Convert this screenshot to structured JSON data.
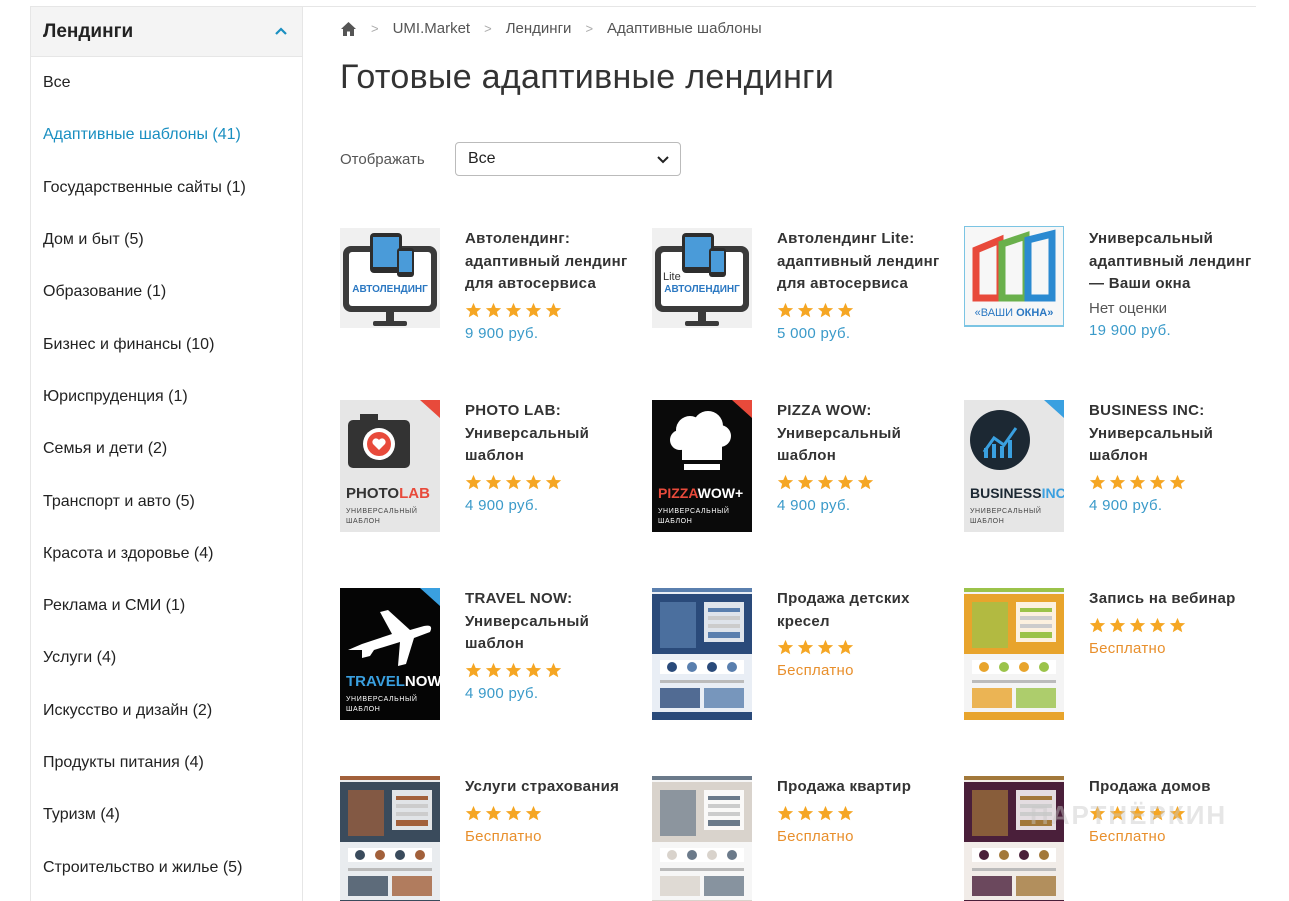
{
  "sidebar": {
    "title": "Лендинги",
    "items": [
      {
        "label": "Все",
        "active": false
      },
      {
        "label": "Адаптивные шаблоны (41)",
        "active": true
      },
      {
        "label": "Государственные сайты (1)",
        "active": false
      },
      {
        "label": "Дом и быт (5)",
        "active": false
      },
      {
        "label": "Образование (1)",
        "active": false
      },
      {
        "label": "Бизнес и финансы (10)",
        "active": false
      },
      {
        "label": "Юриспруденция (1)",
        "active": false
      },
      {
        "label": "Семья и дети (2)",
        "active": false
      },
      {
        "label": "Транспорт и авто (5)",
        "active": false
      },
      {
        "label": "Красота и здоровье (4)",
        "active": false
      },
      {
        "label": "Реклама и СМИ (1)",
        "active": false
      },
      {
        "label": "Услуги (4)",
        "active": false
      },
      {
        "label": "Искусство и дизайн (2)",
        "active": false
      },
      {
        "label": "Продукты питания (4)",
        "active": false
      },
      {
        "label": "Туризм (4)",
        "active": false
      },
      {
        "label": "Строительство и жилье (5)",
        "active": false
      }
    ]
  },
  "breadcrumb": [
    "UMI.Market",
    "Лендинги",
    "Адаптивные шаблоны"
  ],
  "page_title": "Готовые адаптивные лендинги",
  "filter": {
    "label": "Отображать",
    "selected": "Все"
  },
  "colors": {
    "accent": "#1a8fc1",
    "price": "#3a9ac9",
    "free": "#e88f2c",
    "star": "#f5a623"
  },
  "products": [
    {
      "title": "Автолендинг: адаптивный лендинг для автосервиса",
      "stars": 5,
      "rating_text": "",
      "price": "9 900 руб.",
      "free": false,
      "thumb": "autolanding",
      "thumb_text": "АВТОЛЕНДИНГ",
      "thumb_sub": ""
    },
    {
      "title": "Автолендинг Lite: адаптивный лендинг для автосервиса",
      "stars": 4,
      "rating_text": "",
      "price": "5 000 руб.",
      "free": false,
      "thumb": "autolanding-lite",
      "thumb_text": "АВТОЛЕНДИНГ",
      "thumb_sub": "Lite"
    },
    {
      "title": "Универсальный адаптивный лендинг — Ваши окна",
      "stars": 0,
      "rating_text": "Нет оценки",
      "price": "19 900 руб.",
      "free": false,
      "thumb": "windows",
      "thumb_text": "«ВАШИ",
      "thumb_sub": "ОКНА»"
    },
    {
      "title": "PHOTO LAB: Универсальный шаблон",
      "stars": 5,
      "rating_text": "",
      "price": "4 900 руб.",
      "free": false,
      "thumb": "photolab",
      "thumb_text": "PHOTO",
      "thumb_sub": "LAB"
    },
    {
      "title": "PIZZA WOW: Универсальный шаблон",
      "stars": 5,
      "rating_text": "",
      "price": "4 900 руб.",
      "free": false,
      "thumb": "pizzawow",
      "thumb_text": "PIZZA",
      "thumb_sub": "WOW+"
    },
    {
      "title": "BUSINESS INC: Универсальный шаблон",
      "stars": 5,
      "rating_text": "",
      "price": "4 900 руб.",
      "free": false,
      "thumb": "business",
      "thumb_text": "BUSINESS",
      "thumb_sub": "INC"
    },
    {
      "title": "TRAVEL NOW: Универсальный шаблон",
      "stars": 5,
      "rating_text": "",
      "price": "4 900 руб.",
      "free": false,
      "thumb": "travel",
      "thumb_text": "TRAVEL",
      "thumb_sub": "NOW"
    },
    {
      "title": "Продажа детских кресел",
      "stars": 4,
      "rating_text": "",
      "price": "Бесплатно",
      "free": true,
      "thumb": "screenshot-blue",
      "thumb_text": "",
      "thumb_sub": ""
    },
    {
      "title": "Запись на вебинар",
      "stars": 5,
      "rating_text": "",
      "price": "Бесплатно",
      "free": true,
      "thumb": "screenshot-orange",
      "thumb_text": "",
      "thumb_sub": ""
    },
    {
      "title": "Услуги страхования",
      "stars": 4,
      "rating_text": "",
      "price": "Бесплатно",
      "free": true,
      "thumb": "screenshot-dark",
      "thumb_text": "",
      "thumb_sub": ""
    },
    {
      "title": "Продажа квартир",
      "stars": 4,
      "rating_text": "",
      "price": "Бесплатно",
      "free": true,
      "thumb": "screenshot-light",
      "thumb_text": "",
      "thumb_sub": ""
    },
    {
      "title": "Продажа домов",
      "stars": 5,
      "rating_text": "",
      "price": "Бесплатно",
      "free": true,
      "thumb": "screenshot-purple",
      "thumb_text": "",
      "thumb_sub": ""
    }
  ],
  "thumb_caption": "УНИВЕРСАЛЬНЫЙ ШАБЛОН",
  "watermark": "ПАРТНЁРКИН"
}
